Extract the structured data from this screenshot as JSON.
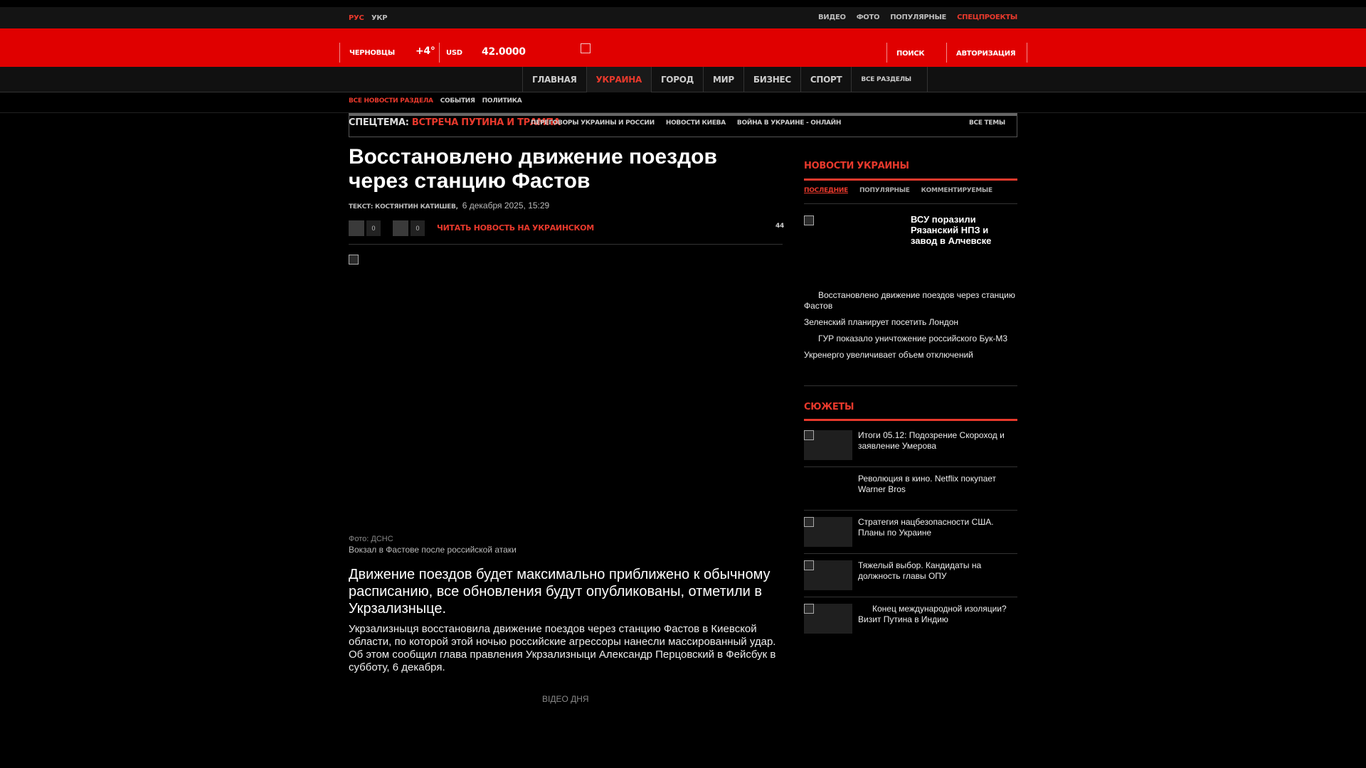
{
  "header": {
    "languages": [
      "РУС",
      "УКР"
    ],
    "top_links": [
      "ВИДЕО",
      "ФОТО",
      "ПОПУЛЯРНЫЕ",
      "СПЕЦПРОЕКТЫ"
    ],
    "city": "ЧЕРНОВЦЫ",
    "temperature": "+4°",
    "currency": "USD",
    "rate": "42.0000",
    "search": "ПОИСК",
    "auth": "АВТОРИЗАЦИЯ"
  },
  "nav": {
    "items": [
      "ГЛАВНАЯ",
      "УКРАИНА",
      "ГОРОД",
      "МИР",
      "БИЗНЕС",
      "СПОРТ",
      "ВСЕ РАЗДЕЛЫ"
    ],
    "active_index": 1
  },
  "subnav": [
    "ВСЕ НОВОСТИ РАЗДЕЛА",
    "СОБЫТИЯ",
    "ПОЛИТИКА"
  ],
  "theme_bar": {
    "label": "СПЕЦТЕМА:",
    "highlight": "ВСТРЕЧА ПУТИНА И ТРАМПА",
    "links": [
      "ПЕРЕГОВОРЫ УКРАИНЫ И РОССИИ",
      "НОВОСТИ КИЕВА",
      "ВОЙНА В УКРАИНЕ - ОНЛАЙН"
    ],
    "all": "ВСЕ ТЕМЫ"
  },
  "article": {
    "title": "Восстановлено движение поездов через станцию Фастов",
    "author": "ТЕКСТ: КОСТЯНТИН КАТИШЕВ,",
    "date": "6 декабря 2025, 15:29",
    "share_count_1": "0",
    "share_count_2": "0",
    "read_ua": "ЧИТАТЬ НОВОСТЬ НА УКРАИНСКОМ",
    "views": "44",
    "photo_credit": "Фото: ДСНС",
    "photo_caption": "Вокзал в Фастове после российской атаки",
    "lead": "Движение поездов будет максимально приближено к обычному расписанию, все обновления будут опубликованы, отметили в Укрзализныце.",
    "body": "Укрзализныця восстановила движение поездов через станцию Фастов в Киевской области, по которой этой ночью российские агрессоры нанесли массированный удар. Об этом сообщил глава правления Укрзализныци Александр Перцовский в Фейсбук в субботу, 6 декабря.",
    "video_label": "ВІДЕО ДНЯ"
  },
  "sidebar": {
    "news_title": "НОВОСТИ УКРАИНЫ",
    "tabs": [
      "ПОСЛЕДНИЕ",
      "ПОПУЛЯРНЫЕ",
      "КОММЕНТИРУЕМЫЕ"
    ],
    "top_story": "ВСУ поразили Рязанский НПЗ и завод в Алчевске",
    "news": [
      "Восстановлено движение поездов через станцию Фастов",
      "Зеленский планирует посетить Лондон",
      "ГУР показало уничтожение российского Бук-М3",
      "Укренерго увеличивает объем отключений"
    ],
    "stories_title": "СЮЖЕТЫ",
    "stories": [
      "Итоги 05.12: Подозрение Скороход и заявление Умерова",
      "Революция в кино. Netflix покупает Warner Bros",
      "Стратегия нацбезопасности США. Планы по Украине",
      "Тяжелый выбор. Кандидаты на должность главы ОПУ",
      "Конец международной изоляции? Визит Путина в Индию"
    ]
  },
  "colors": {
    "brand_red": "#e00000",
    "accent": "#e8392c",
    "background": "#000000"
  }
}
